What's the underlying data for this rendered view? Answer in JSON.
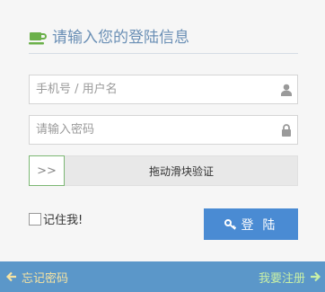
{
  "header": {
    "title": "请输入您的登陆信息",
    "icon": "coffee-cup-icon"
  },
  "phone_field": {
    "value": "",
    "placeholder": "手机号 / 用户名",
    "icon": "user-icon"
  },
  "password_field": {
    "value": "",
    "placeholder": "请输入密码",
    "icon": "lock-icon"
  },
  "slider": {
    "handle_glyph": ">>",
    "label": "拖动滑块验证"
  },
  "remember": {
    "label": "记住我!",
    "checked": false
  },
  "login_button": {
    "label": "登 陆",
    "icon": "key-icon"
  },
  "toolbar": {
    "forgot_label": "忘记密码",
    "register_label": "我要注册",
    "background": "#5b97c9"
  },
  "colors": {
    "accent": "#4a8bd3",
    "title": "#6a8fb5",
    "slider_border": "#7cb773"
  }
}
